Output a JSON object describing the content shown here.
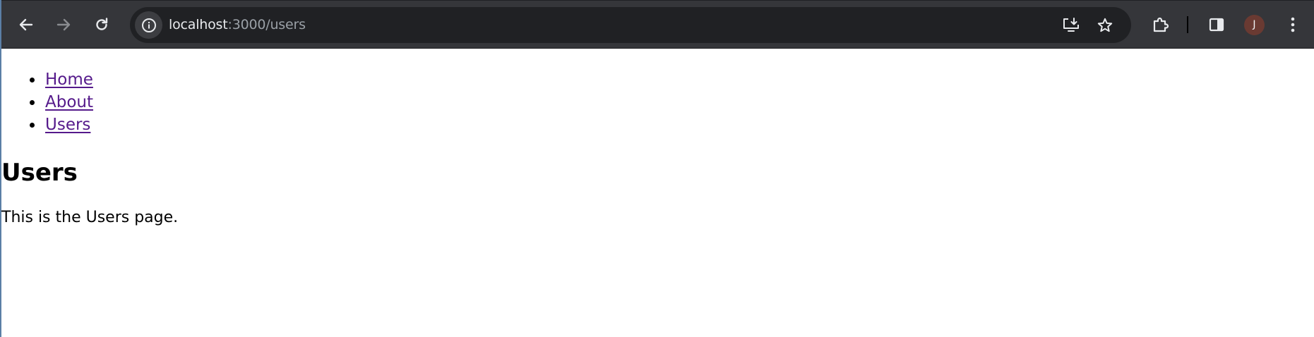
{
  "browser": {
    "url_host": "localhost",
    "url_rest": ":3000/users",
    "profile_initial": "J",
    "icons": {
      "back": "arrow-left-icon",
      "forward": "arrow-right-icon",
      "reload": "reload-icon",
      "site_info": "info-icon",
      "install": "install-app-icon",
      "bookmark": "star-icon",
      "extensions": "puzzle-icon",
      "side_panel": "side-panel-icon",
      "menu": "kebab-menu-icon"
    },
    "colors": {
      "toolbar": "#35363a",
      "omnibox": "#202124",
      "avatar": "#6a3a32"
    }
  },
  "page": {
    "nav": [
      {
        "label": "Home"
      },
      {
        "label": "About"
      },
      {
        "label": "Users"
      }
    ],
    "title": "Users",
    "body_text": "This is the Users page.",
    "link_color": "#551a8b"
  }
}
